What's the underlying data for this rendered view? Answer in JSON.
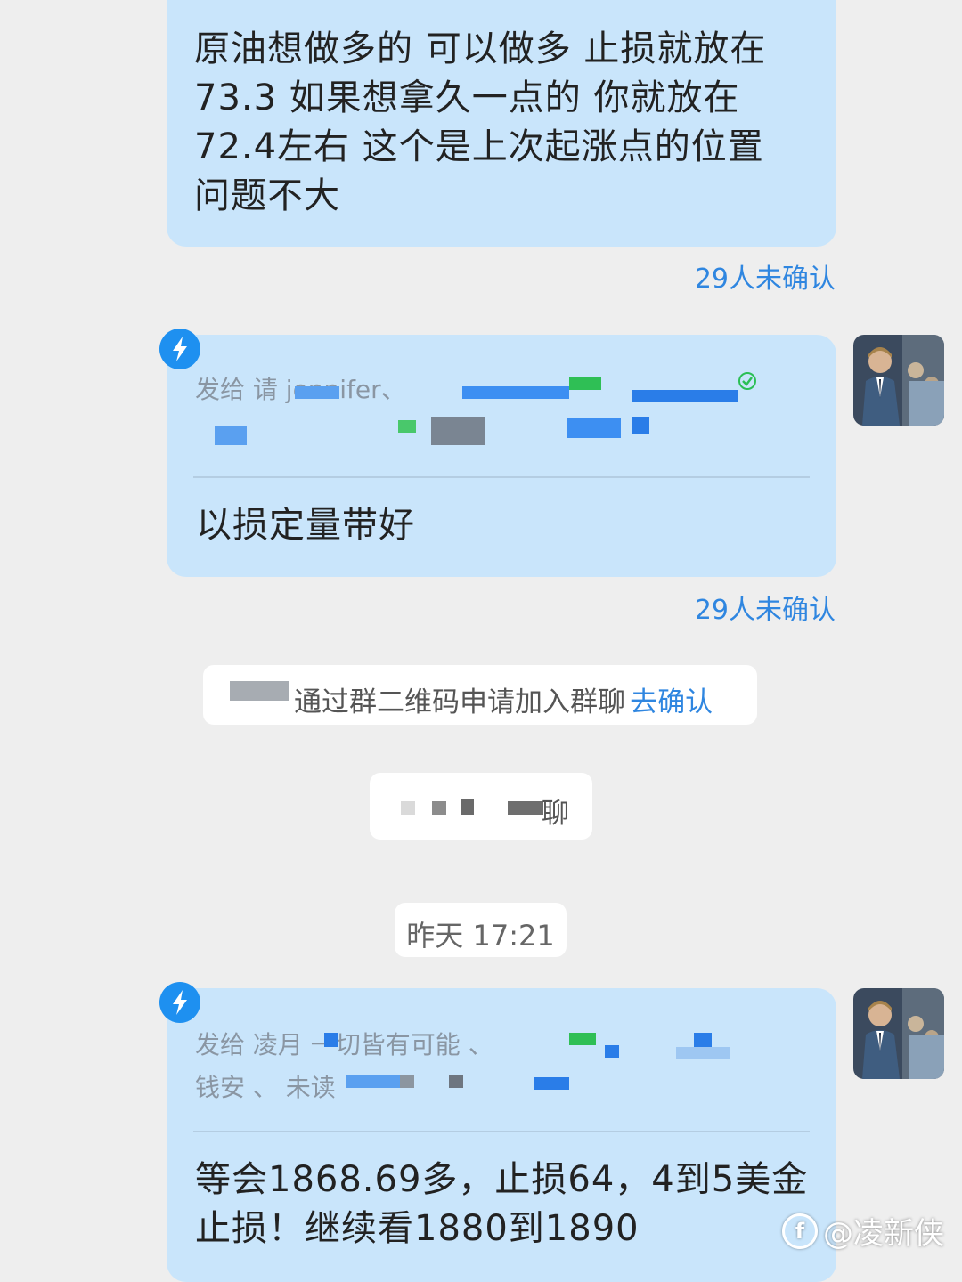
{
  "messages": [
    {
      "text": "原油想做多的 可以做多  止损就放在73.3 如果想拿久一点的 你就放在72.4左右 这个是上次起涨点的位置 问题不大",
      "receipt": "29人未确认"
    },
    {
      "recipients_line1": "发给 请  jennifer、",
      "recipients_line2": "",
      "text": "以损定量带好",
      "receipt": "29人未确认"
    },
    {
      "recipients_line1": "发给 凌月  一切皆有可能 、",
      "recipients_line2": "钱安 、  未读",
      "text": "等会1868.69多，止损64，4到5美金止损！继续看1880到1890"
    }
  ],
  "system": {
    "join_notice": "通过群二维码申请加入群聊",
    "join_link": "去确认",
    "group_notice": "聊",
    "timestamp": "昨天 17:21"
  },
  "watermark": "@凌新侠",
  "colors": {
    "bubble": "#c9e5fb",
    "accent": "#2f86e0",
    "background": "#eeeeee",
    "bolt": "#1e90f0"
  },
  "icons": [
    "lightning-icon",
    "avatar-image",
    "check-circle-icon"
  ]
}
